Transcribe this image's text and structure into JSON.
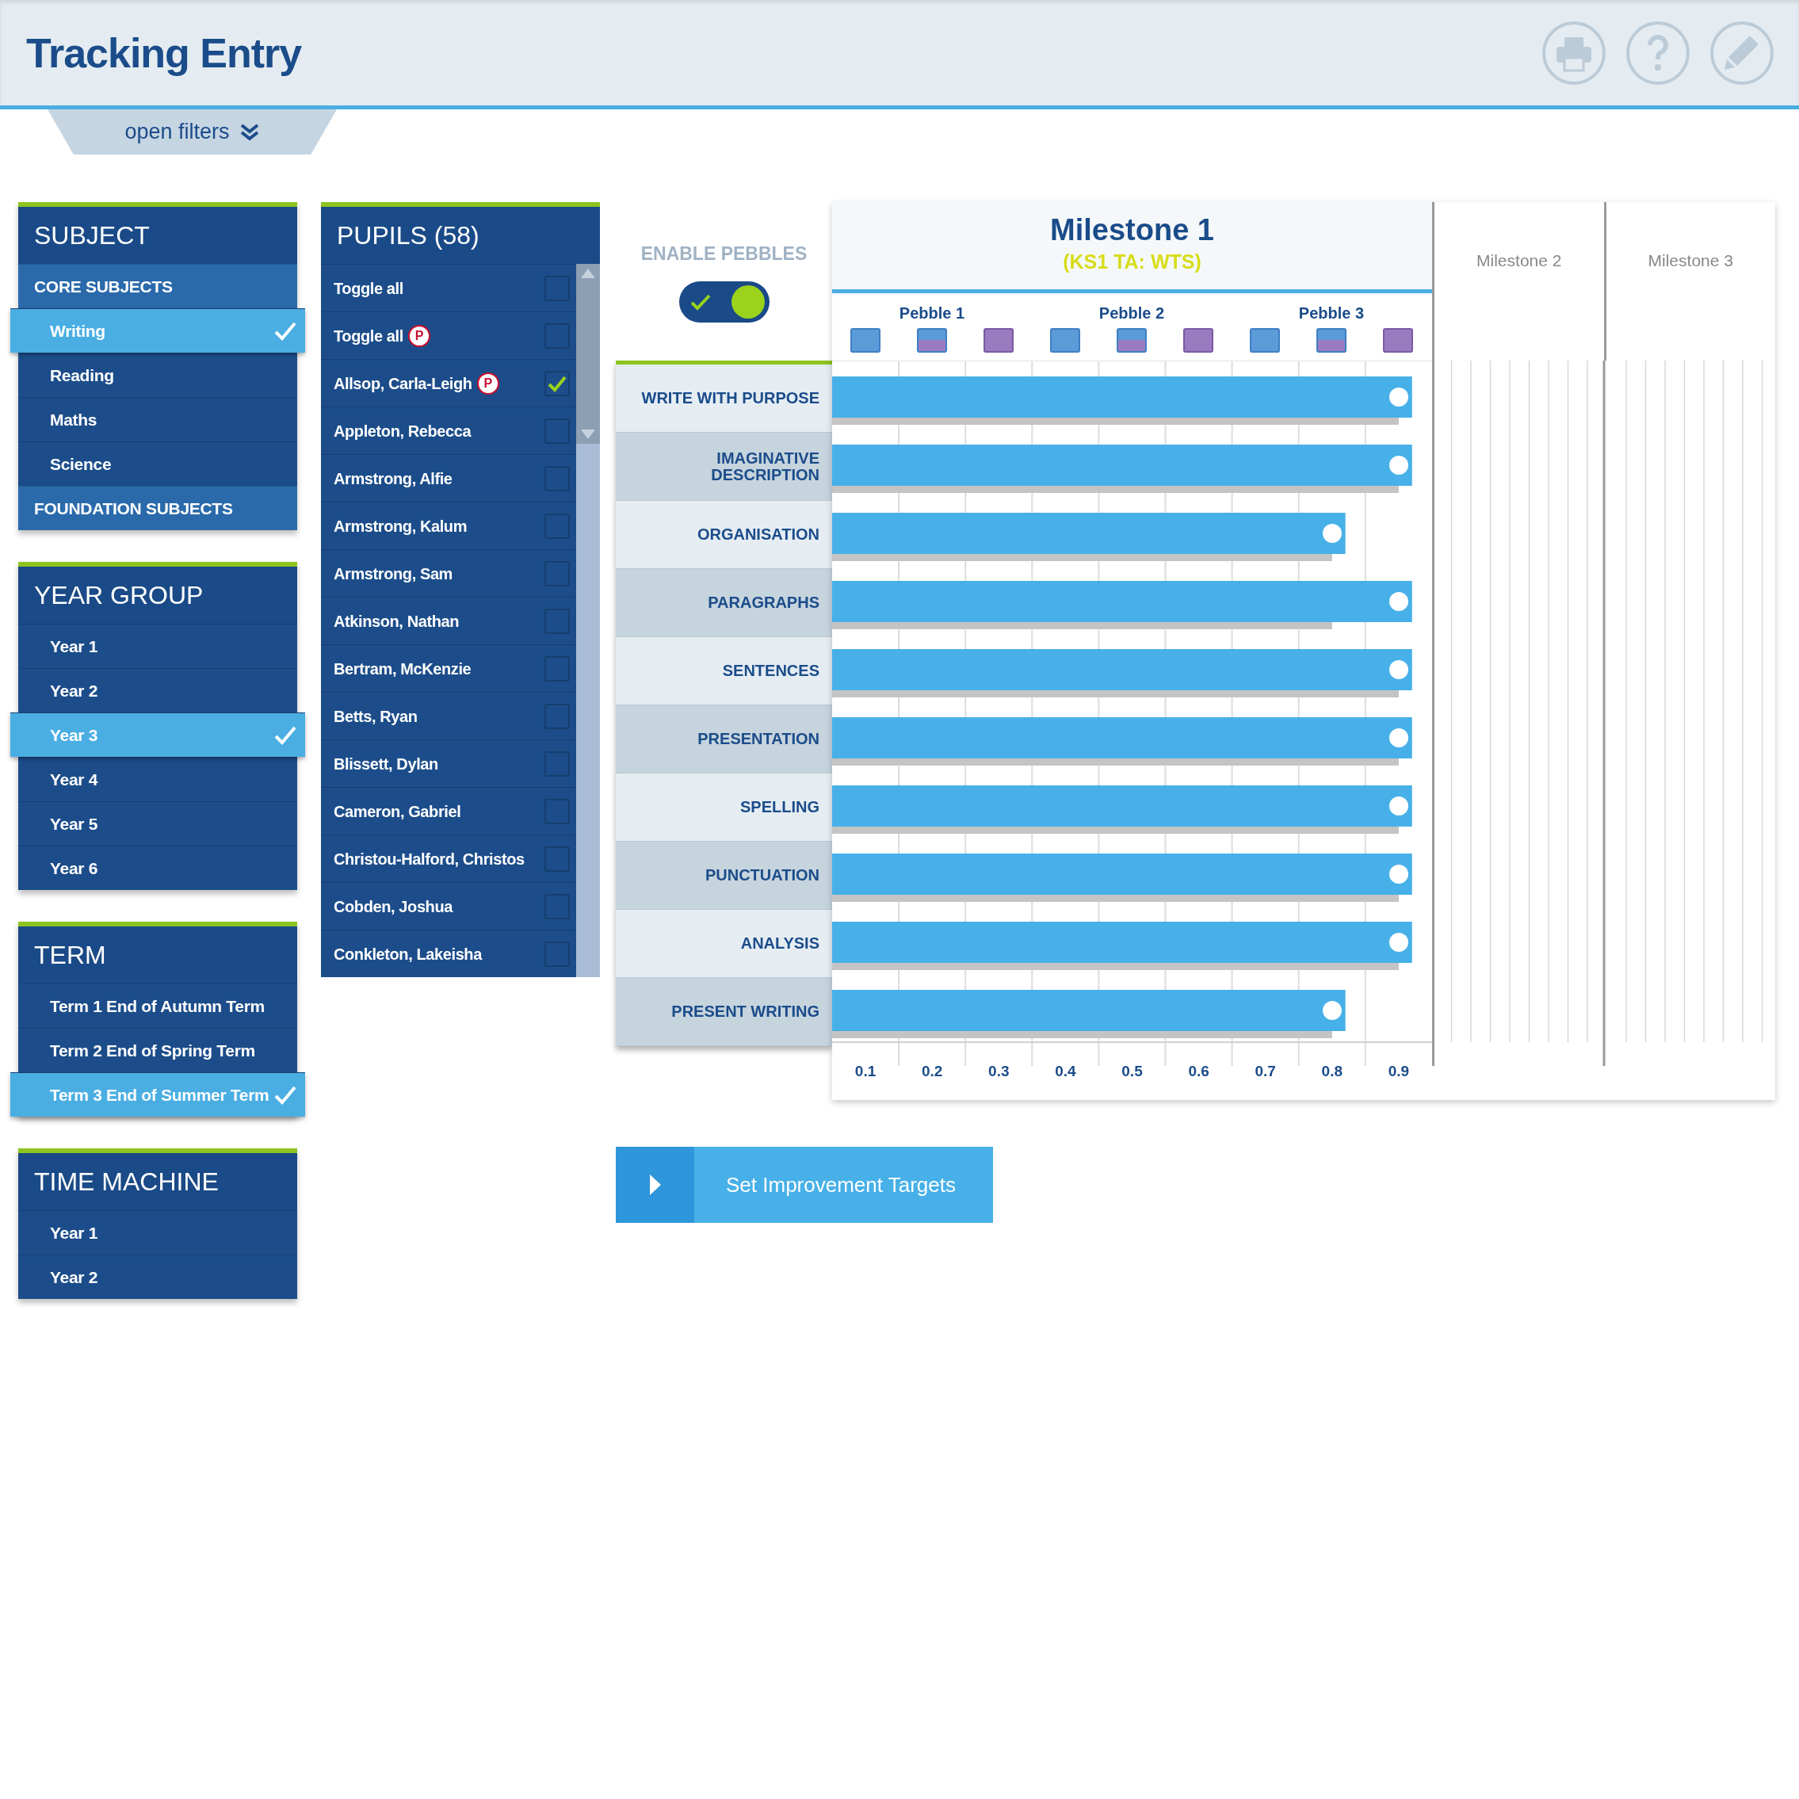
{
  "header": {
    "title": "Tracking Entry"
  },
  "filters_tab": {
    "label": "open filters"
  },
  "filter_panels": [
    {
      "title": "SUBJECT",
      "items": [
        {
          "kind": "category",
          "label": "CORE SUBJECTS"
        },
        {
          "kind": "option",
          "label": "Writing",
          "selected": true
        },
        {
          "kind": "option",
          "label": "Reading",
          "selected": false
        },
        {
          "kind": "option",
          "label": "Maths",
          "selected": false
        },
        {
          "kind": "option",
          "label": "Science",
          "selected": false
        },
        {
          "kind": "category",
          "label": "FOUNDATION SUBJECTS"
        }
      ]
    },
    {
      "title": "YEAR GROUP",
      "items": [
        {
          "kind": "option",
          "label": "Year 1",
          "selected": false
        },
        {
          "kind": "option",
          "label": "Year 2",
          "selected": false
        },
        {
          "kind": "option",
          "label": "Year 3",
          "selected": true
        },
        {
          "kind": "option",
          "label": "Year 4",
          "selected": false
        },
        {
          "kind": "option",
          "label": "Year 5",
          "selected": false
        },
        {
          "kind": "option",
          "label": "Year 6",
          "selected": false
        }
      ]
    },
    {
      "title": "TERM",
      "items": [
        {
          "kind": "option",
          "label": "Term 1 End of Autumn Term",
          "selected": false
        },
        {
          "kind": "option",
          "label": "Term 2 End of Spring Term",
          "selected": false
        },
        {
          "kind": "option",
          "label": "Term 3 End of Summer Term",
          "selected": true
        }
      ]
    },
    {
      "title": "TIME MACHINE",
      "items": [
        {
          "kind": "option",
          "label": "Year 1",
          "selected": false
        },
        {
          "kind": "option",
          "label": "Year 2",
          "selected": false
        }
      ]
    }
  ],
  "pupils": {
    "title": "PUPILS (58)",
    "rows": [
      {
        "label": "Toggle all",
        "checked": false
      },
      {
        "label": "Toggle all",
        "badge": "P",
        "checked": false
      },
      {
        "label": "Allsop, Carla-Leigh",
        "badge": "P",
        "checked": true
      },
      {
        "label": "Appleton, Rebecca",
        "checked": false
      },
      {
        "label": "Armstrong, Alfie",
        "checked": false
      },
      {
        "label": "Armstrong, Kalum",
        "checked": false
      },
      {
        "label": "Armstrong, Sam",
        "checked": false
      },
      {
        "label": "Atkinson, Nathan",
        "checked": false
      },
      {
        "label": "Bertram, McKenzie",
        "checked": false
      },
      {
        "label": "Betts, Ryan",
        "checked": false
      },
      {
        "label": "Blissett, Dylan",
        "checked": false
      },
      {
        "label": "Cameron, Gabriel",
        "checked": false
      },
      {
        "label": "Christou-Halford, Christos",
        "checked": false
      },
      {
        "label": "Cobden, Joshua",
        "checked": false
      },
      {
        "label": "Conkleton, Lakeisha",
        "checked": false
      }
    ]
  },
  "pebbles_toggle": {
    "label": "ENABLE PEBBLES",
    "on": true
  },
  "milestones": [
    {
      "title": "Milestone 1",
      "subtitle": "(KS1 TA: WTS)",
      "selected": true
    },
    {
      "title": "Milestone 2",
      "selected": false
    },
    {
      "title": "Milestone 3",
      "selected": false
    }
  ],
  "pebbles": [
    {
      "label": "Pebble 1"
    },
    {
      "label": "Pebble 2"
    },
    {
      "label": "Pebble 3"
    }
  ],
  "chart": {
    "chart_data": {
      "type": "bar",
      "orientation": "horizontal",
      "categories": [
        "WRITE WITH PURPOSE",
        "IMAGINATIVE DESCRIPTION",
        "ORGANISATION",
        "PARAGRAPHS",
        "SENTENCES",
        "PRESENTATION",
        "SPELLING",
        "PUNCTUATION",
        "ANALYSIS",
        "PRESENT WRITING"
      ],
      "series": [
        {
          "color": "#47b0e8",
          "values": [
            0.92,
            0.92,
            0.82,
            0.92,
            0.92,
            0.92,
            0.92,
            0.92,
            0.92,
            0.82
          ]
        },
        {
          "color": "#c4c4c4",
          "values": [
            0.9,
            0.9,
            0.8,
            0.8,
            0.9,
            0.9,
            0.9,
            0.9,
            0.9,
            0.8
          ]
        }
      ],
      "xlim": [
        0.05,
        0.95
      ],
      "xticks": [
        0.1,
        0.2,
        0.3,
        0.4,
        0.5,
        0.6,
        0.7,
        0.8,
        0.9
      ]
    }
  },
  "action_button": {
    "label": "Set Improvement Targets"
  }
}
